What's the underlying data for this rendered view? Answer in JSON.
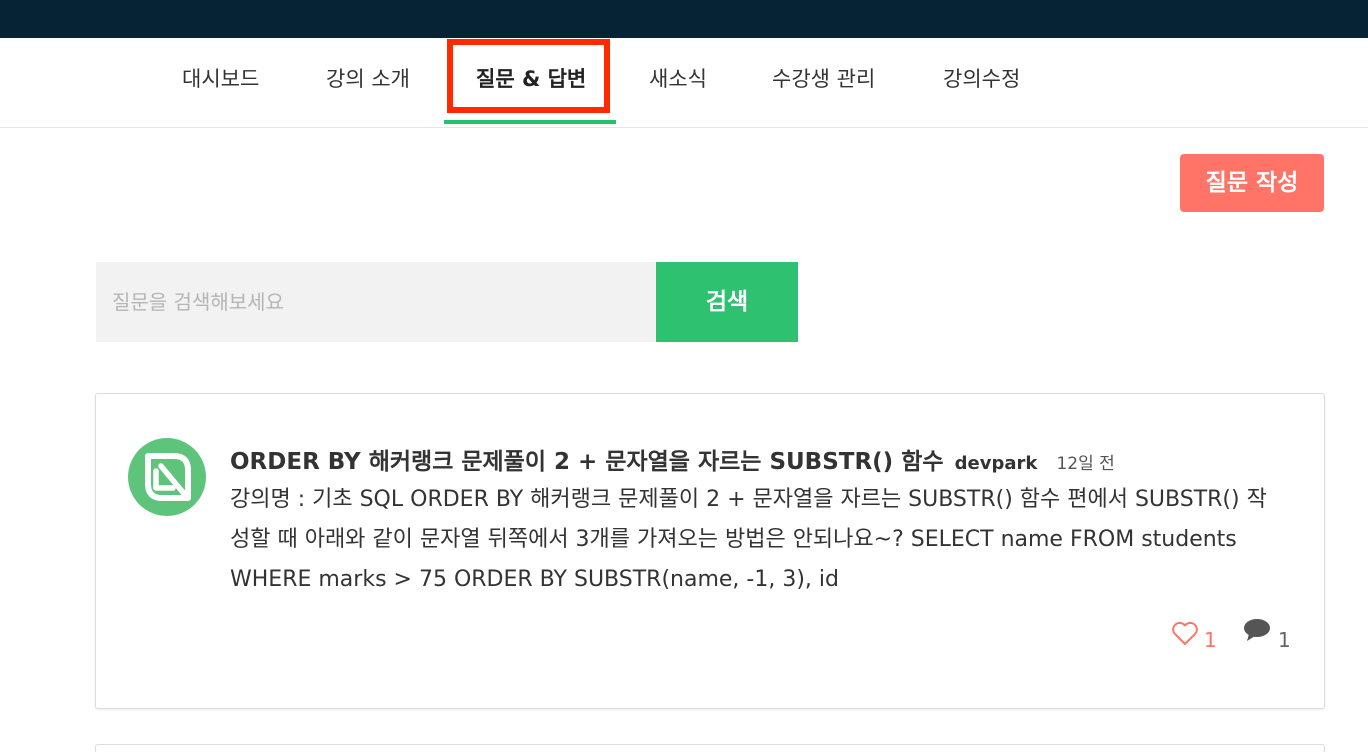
{
  "nav": {
    "items": [
      {
        "label": "대시보드"
      },
      {
        "label": "강의 소개"
      },
      {
        "label": "질문 & 답변"
      },
      {
        "label": "새소식"
      },
      {
        "label": "수강생 관리"
      },
      {
        "label": "강의수정"
      }
    ],
    "active_index": 2
  },
  "actions": {
    "write_question_label": "질문 작성"
  },
  "search": {
    "placeholder": "질문을 검색해보세요",
    "value": "",
    "button_label": "검색"
  },
  "questions": [
    {
      "title": "ORDER BY 해커랭크 문제풀이 2 + 문자열을 자르는 SUBSTR() 함수",
      "author": "devpark",
      "time": "12일 전",
      "body": "강의명 : 기초 SQL ORDER BY 해커랭크 문제풀이 2 + 문자열을 자르는 SUBSTR() 함수 편에서 SUBSTR() 작성할 때 아래와 같이 문자열 뒤쪽에서 3개를 가져오는 방법은 안되나요~? SELECT name FROM students WHERE marks > 75 ORDER BY SUBSTR(name, -1, 3), id",
      "likes": "1",
      "comments": "1"
    }
  ],
  "colors": {
    "topbar": "#062235",
    "accent_green": "#22c36c",
    "write_button": "#ff7467",
    "search_button": "#2ec270",
    "highlight": "#ff2a00",
    "avatar": "#5ec47c"
  },
  "icons": {
    "avatar": "leaf-avatar-icon",
    "like": "heart-icon",
    "comment": "speech-bubble-icon"
  }
}
